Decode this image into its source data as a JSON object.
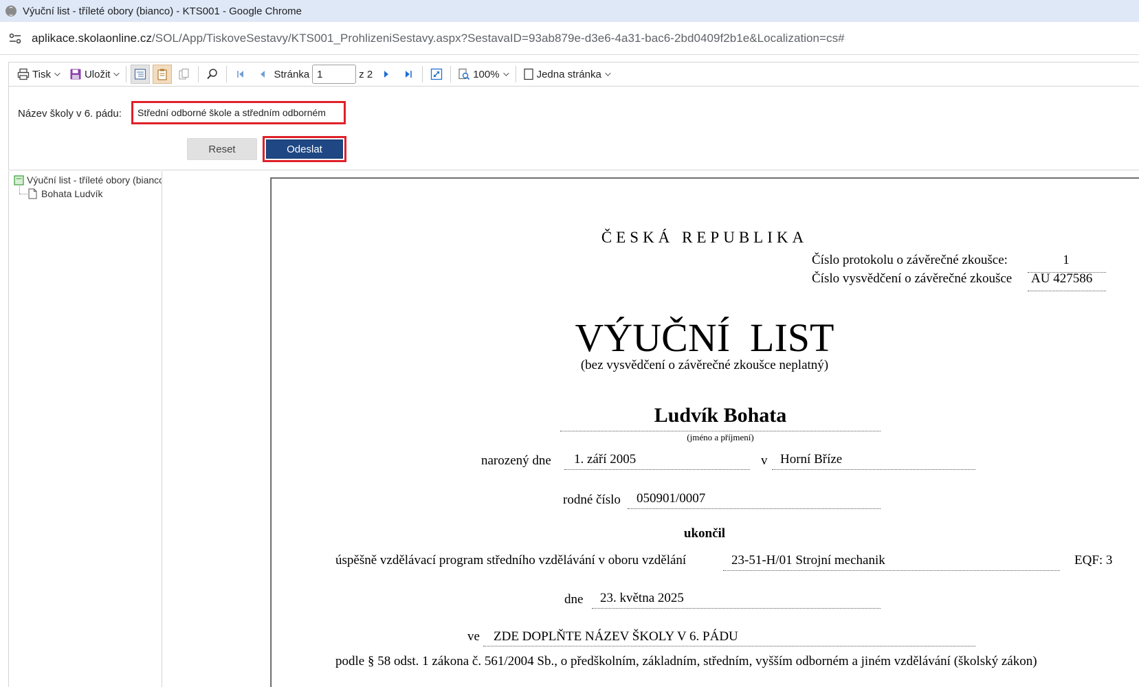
{
  "window": {
    "title": "Výuční list - tříleté obory (bianco) - KTS001 - Google Chrome",
    "url_host": "aplikace.skolaonline.cz",
    "url_path": "/SOL/App/TiskoveSestavy/KTS001_ProhlizeniSestavy.aspx?SestavaID=93ab879e-d3e6-4a31-bac6-2bd0409f2b1e&Localization=cs#"
  },
  "toolbar": {
    "print_label": "Tisk",
    "save_label": "Uložit",
    "page_label": "Stránka",
    "page_value": "1",
    "page_of": "z 2",
    "zoom_label": "100%",
    "view_mode_label": "Jedna stránka"
  },
  "params": {
    "school_name_label": "Název školy v 6. pádu:",
    "school_name_value": "Střední odborné škole a středním odborném",
    "reset_label": "Reset",
    "submit_label": "Odeslat"
  },
  "tree": {
    "root_label": "Výuční list - tříleté obory (bianco)",
    "child_label": "Bohata Ludvík"
  },
  "document": {
    "country": "ČESKÁ REPUBLIKA",
    "protocol_label": "Číslo protokolu o závěrečné zkoušce:",
    "protocol_value": "1",
    "certificate_label": "Číslo vysvědčení o závěrečné zkoušce",
    "certificate_value": "AU 427586",
    "heading": "VÝUČNÍ  LIST",
    "subheading": "(bez vysvědčení o závěrečné zkoušce neplatný)",
    "student_name": "Ludvík Bohata",
    "name_caption": "(jméno a příjmení)",
    "born_label": "narozený dne",
    "born_date": "1. září 2005",
    "born_in_label": "v",
    "born_place": "Horní Bříze",
    "birth_number_label": "rodné číslo",
    "birth_number": "050901/0007",
    "completed_label": "ukončil",
    "program_text": "úspěšně vzdělávací program středního vzdělávání v oboru vzdělání",
    "field_value": "23-51-H/01 Strojní mechanik",
    "eqf": "EQF: 3",
    "date_label": "dne",
    "date_value": "23. května 2025",
    "school_label": "ve",
    "school_value": "ZDE DOPLŇTE NÁZEV ŠKOLY V 6. PÁDU",
    "law_text": "podle § 58 odst. 1 zákona č. 561/2004 Sb., o předškolním, základním, středním, vyšším odborném a jiném vzdělávání (školský zákon)"
  }
}
